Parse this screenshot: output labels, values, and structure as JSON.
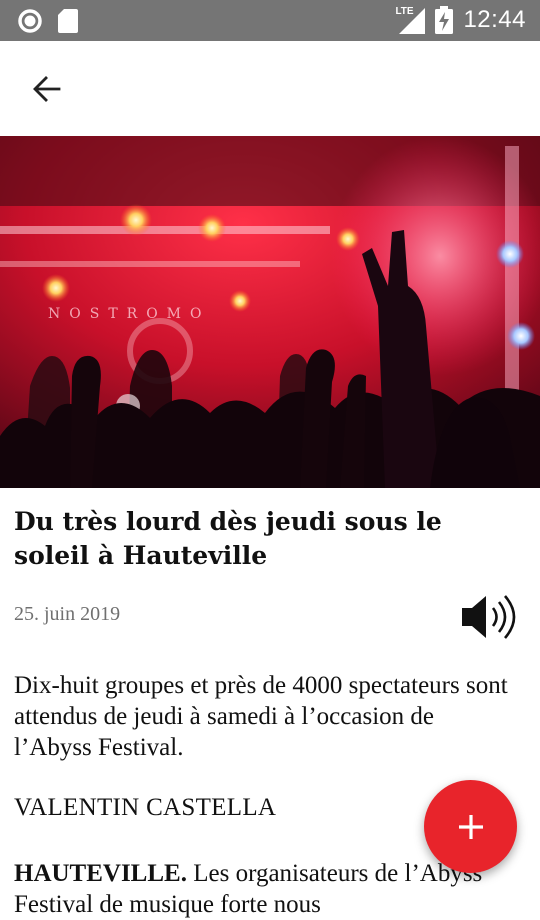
{
  "status_bar": {
    "time": "12:44",
    "network": "LTE",
    "icons": [
      "circle-notification-icon",
      "sd-card-icon",
      "signal-icon",
      "battery-charging-icon"
    ]
  },
  "toolbar": {
    "back_icon": "arrow-left-icon"
  },
  "hero": {
    "stage_text": "NOSTROMO",
    "accent": "#e8242b"
  },
  "article": {
    "title": "Du très lourd dès jeudi sous le soleil à Hauteville",
    "date": "25. juin 2019",
    "audio_icon": "speaker-icon",
    "lead": "Dix-huit groupes et près de 4000 spectateurs sont attendus de jeudi à samedi à l’occasion de l’Abyss Festival.",
    "author": "VALENTIN CASTELLA",
    "body_dateline": "HAUTEVILLE.",
    "body_text": " Les organisateurs de l’Abyss Festival de musique forte nous"
  },
  "fab": {
    "icon": "plus-icon",
    "color": "#e8242b"
  }
}
